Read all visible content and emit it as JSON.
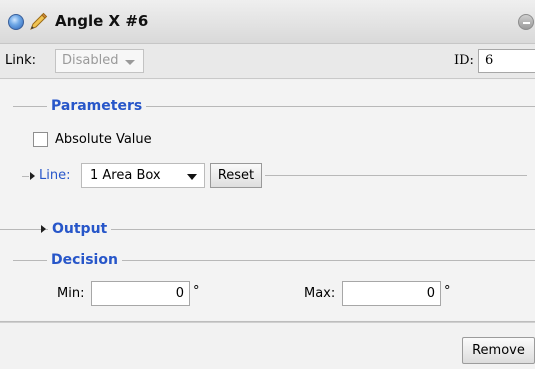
{
  "window": {
    "title": "Angle X #6",
    "icons": [
      "status-orb-icon",
      "pencil-icon",
      "collapse-icon"
    ]
  },
  "link": {
    "label": "Link:",
    "value": "Disabled",
    "id_label": "ID:",
    "id_value": "6"
  },
  "parameters": {
    "title": "Parameters",
    "absolute_value_label": "Absolute Value",
    "absolute_value_checked": false,
    "line_label": "Line:",
    "line_value": "1 Area Box",
    "reset_label": "Reset"
  },
  "output": {
    "title": "Output"
  },
  "decision": {
    "title": "Decision",
    "min_label": "Min:",
    "min_value": "0",
    "max_label": "Max:",
    "max_value": "0",
    "unit": "°"
  },
  "footer": {
    "remove_label": "Remove"
  },
  "colors": {
    "section_title": "#2756c9",
    "orb": "#2c63b8",
    "pencil": "#e3a43a"
  }
}
